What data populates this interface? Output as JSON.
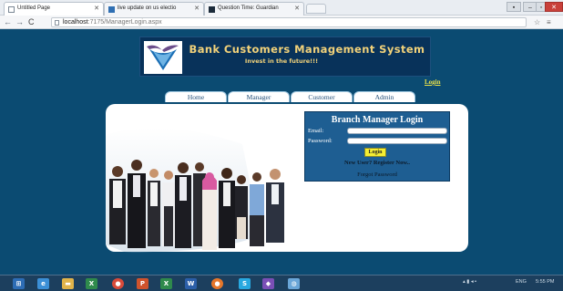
{
  "browser": {
    "tabs": [
      {
        "title": "Untitled Page",
        "active": true
      },
      {
        "title": "live update on us electio",
        "active": false
      },
      {
        "title": "Question Time: Guardian",
        "active": false
      }
    ],
    "url_host": "localhost",
    "url_rest": ":7175/ManagerLogin.aspx",
    "back_icon": "arrow-left-icon",
    "forward_icon": "arrow-right-icon",
    "reload_icon": "reload-icon"
  },
  "brand": {
    "title": "Bank Customers Management System",
    "tagline": "Invest in the future!!!",
    "colors": {
      "banner_bg": "#08325a",
      "title": "#f2d27a",
      "page_bg": "#0b4b72"
    }
  },
  "top_login_link": "Login",
  "nav": [
    {
      "label": "Home"
    },
    {
      "label": "Manager"
    },
    {
      "label": "Customer"
    },
    {
      "label": "Admin"
    }
  ],
  "login": {
    "title": "Branch Manager Login",
    "email_label": "Email:",
    "email_value": "",
    "password_label": "Password:",
    "password_value": "",
    "submit_label": "Login",
    "register_text": "New User? Register Now..",
    "forgot_text": "Forgot Password",
    "colors": {
      "box_bg": "#1e5e92",
      "button_bg": "#f5ee32"
    }
  },
  "taskbar": {
    "icons": [
      "windows-start-icon",
      "ie-icon",
      "file-explorer-icon",
      "excel-icon",
      "chrome-icon",
      "powerpoint-icon",
      "excel-icon",
      "word-icon",
      "firefox-icon",
      "skype-icon",
      "visual-studio-icon",
      "paint-icon"
    ],
    "tray_left": "ENG",
    "clock_time": "5:55 PM"
  }
}
